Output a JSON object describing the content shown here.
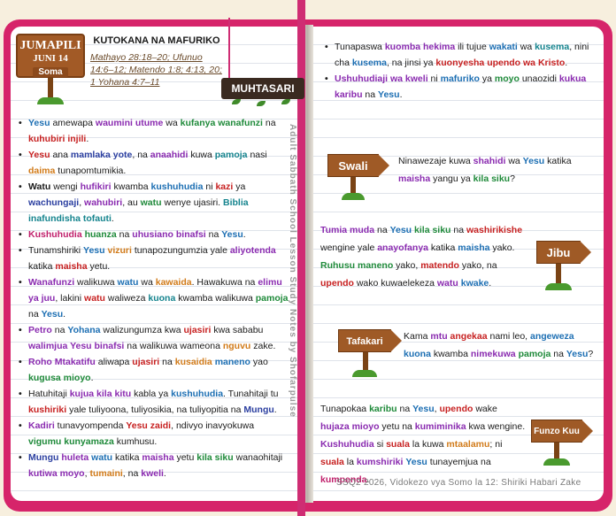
{
  "header": {
    "day": "JUMAPILI",
    "date": "JUNI 14",
    "read_label": "Soma",
    "topic": "KUTOKANA NA MAFURIKO",
    "refs": [
      "Mathayo 28:18–20; Ufunuo 14:6–12; Matendo 1:8; 4:13, 20; 1 Yohana 4:7–11"
    ],
    "summary_label": "MUHTASARI"
  },
  "left_list": [
    [
      [
        "Yesu",
        "blue"
      ],
      [
        " amewapa ",
        ""
      ],
      [
        "waumini utume",
        "purple"
      ],
      [
        " wa ",
        ""
      ],
      [
        "kufanya wanafunzi",
        "green"
      ],
      [
        " na ",
        ""
      ],
      [
        "kuhubiri injili",
        "red"
      ],
      [
        ".",
        ""
      ]
    ],
    [
      [
        "Yesu",
        "red"
      ],
      [
        " ana ",
        ""
      ],
      [
        "mamlaka yote",
        "navy"
      ],
      [
        ", na ",
        ""
      ],
      [
        "anaahidi",
        "purple"
      ],
      [
        " kuwa ",
        ""
      ],
      [
        "pamoja",
        "teal"
      ],
      [
        " nasi ",
        ""
      ],
      [
        "daima",
        "orange"
      ],
      [
        " tunapomtumikia.",
        ""
      ]
    ],
    [
      [
        "Watu",
        "b"
      ],
      [
        " wengi ",
        ""
      ],
      [
        "hufikiri",
        "purple"
      ],
      [
        " kwamba ",
        ""
      ],
      [
        "kushuhudia",
        "blue"
      ],
      [
        " ni ",
        ""
      ],
      [
        "kazi",
        "red"
      ],
      [
        " ya ",
        ""
      ],
      [
        "wachungaji",
        "navy"
      ],
      [
        ", ",
        ""
      ],
      [
        "wahubiri",
        "purple"
      ],
      [
        ", au ",
        ""
      ],
      [
        "watu",
        "green"
      ],
      [
        " wenye ujasiri. ",
        ""
      ],
      [
        "Biblia inafundisha tofauti",
        "teal"
      ],
      [
        ".",
        ""
      ]
    ],
    [
      [
        "Kushuhudia",
        "pink"
      ],
      [
        " ",
        ""
      ],
      [
        "huanza",
        "green"
      ],
      [
        " na ",
        ""
      ],
      [
        "uhusiano binafsi",
        "purple"
      ],
      [
        " na ",
        ""
      ],
      [
        "Yesu",
        "blue"
      ],
      [
        ".",
        ""
      ]
    ],
    [
      [
        "Tunamshiriki ",
        ""
      ],
      [
        "Yesu",
        "blue"
      ],
      [
        " ",
        ""
      ],
      [
        "vizuri",
        "orange"
      ],
      [
        " tunapozungumzia yale ",
        ""
      ],
      [
        "aliyotenda",
        "purple"
      ],
      [
        " katika ",
        ""
      ],
      [
        "maisha",
        "red"
      ],
      [
        " yetu.",
        ""
      ]
    ],
    [
      [
        "Wanafunzi",
        "purple"
      ],
      [
        " walikuwa ",
        ""
      ],
      [
        "watu",
        "blue"
      ],
      [
        " wa ",
        ""
      ],
      [
        "kawaida",
        "orange"
      ],
      [
        ". Hawakuwa na ",
        ""
      ],
      [
        "elimu ya juu",
        "purple"
      ],
      [
        ", lakini ",
        ""
      ],
      [
        "watu",
        "red"
      ],
      [
        " waliweza ",
        ""
      ],
      [
        "kuona",
        "teal"
      ],
      [
        " kwamba walikuwa ",
        ""
      ],
      [
        "pamoja",
        "green"
      ],
      [
        " na ",
        ""
      ],
      [
        "Yesu",
        "blue"
      ],
      [
        ".",
        ""
      ]
    ],
    [
      [
        "Petro",
        "purple"
      ],
      [
        " na ",
        ""
      ],
      [
        "Yohana",
        "blue"
      ],
      [
        " walizungumza kwa ",
        ""
      ],
      [
        "ujasiri",
        "red"
      ],
      [
        " kwa sababu ",
        ""
      ],
      [
        "walimjua Yesu binafsi",
        "purple"
      ],
      [
        " na walikuwa wameona ",
        ""
      ],
      [
        "nguvu",
        "orange"
      ],
      [
        " zake.",
        ""
      ]
    ],
    [
      [
        "Roho Mtakatifu",
        "purple"
      ],
      [
        " aliwapa ",
        ""
      ],
      [
        "ujasiri",
        "red"
      ],
      [
        " na ",
        ""
      ],
      [
        "kusaidia",
        "orange"
      ],
      [
        " ",
        ""
      ],
      [
        "maneno",
        "blue"
      ],
      [
        " yao ",
        ""
      ],
      [
        "kugusa mioyo",
        "green"
      ],
      [
        ".",
        ""
      ]
    ],
    [
      [
        "Hatuhitaji ",
        ""
      ],
      [
        "kujua kila kitu",
        "purple"
      ],
      [
        " kabla ya ",
        ""
      ],
      [
        "kushuhudia",
        "blue"
      ],
      [
        ". Tunahitaji tu ",
        ""
      ],
      [
        "kushiriki",
        "red"
      ],
      [
        " yale tuliyoona, tuliyosikia, na tuliyopitia na ",
        ""
      ],
      [
        "Mungu",
        "navy"
      ],
      [
        ".",
        ""
      ]
    ],
    [
      [
        "Kadiri",
        "purple"
      ],
      [
        " tunavyompenda ",
        ""
      ],
      [
        "Yesu zaidi",
        "red"
      ],
      [
        ", ndivyo inavyokuwa ",
        ""
      ],
      [
        "vigumu kunyamaza",
        "green"
      ],
      [
        " kumhusu.",
        ""
      ]
    ],
    [
      [
        "Mungu",
        "navy"
      ],
      [
        " ",
        ""
      ],
      [
        "huleta",
        "purple"
      ],
      [
        " ",
        ""
      ],
      [
        "watu",
        "blue"
      ],
      [
        " katika ",
        ""
      ],
      [
        "maisha",
        "purple"
      ],
      [
        " yetu ",
        ""
      ],
      [
        "kila siku",
        "green"
      ],
      [
        " wanaohitaji ",
        ""
      ],
      [
        "kutiwa moyo",
        "purple"
      ],
      [
        ", ",
        ""
      ],
      [
        "tumaini",
        "orange"
      ],
      [
        ", na ",
        ""
      ],
      [
        "kweli",
        "purple"
      ],
      [
        ".",
        ""
      ]
    ]
  ],
  "right_list": [
    [
      [
        "Tunapaswa ",
        ""
      ],
      [
        "kuomba hekima",
        "purple"
      ],
      [
        " ili tujue ",
        ""
      ],
      [
        "wakati",
        "blue"
      ],
      [
        " wa ",
        ""
      ],
      [
        "kusema",
        "teal"
      ],
      [
        ", nini cha ",
        ""
      ],
      [
        "kusema",
        "blue"
      ],
      [
        ", na jinsi ya ",
        ""
      ],
      [
        "kuonyesha upendo wa Kristo",
        "red"
      ],
      [
        ".",
        ""
      ]
    ],
    [
      [
        "Ushuhudiaji wa kweli",
        "purple"
      ],
      [
        " ni ",
        ""
      ],
      [
        "mafuriko",
        "blue"
      ],
      [
        " ya ",
        ""
      ],
      [
        "moyo",
        "green"
      ],
      [
        " unaozidi ",
        ""
      ],
      [
        "kukua karibu",
        "purple"
      ],
      [
        " na ",
        ""
      ],
      [
        "Yesu",
        "blue"
      ],
      [
        ".",
        ""
      ]
    ]
  ],
  "vertical_note": "Adult Sabbath School Lesson Study Notes by Shofarpulse",
  "swali": {
    "label": "Swali",
    "text": [
      [
        "Ninawezaje kuwa ",
        ""
      ],
      [
        "shahidi",
        "purple"
      ],
      [
        " wa ",
        ""
      ],
      [
        "Yesu",
        "blue"
      ],
      [
        " katika ",
        ""
      ],
      [
        "maisha",
        "purple"
      ],
      [
        " yangu ya ",
        ""
      ],
      [
        "kila siku",
        "green"
      ],
      [
        "?",
        ""
      ]
    ]
  },
  "jibu": {
    "label": "Jibu",
    "text": [
      [
        "Tumia muda",
        "purple"
      ],
      [
        " na ",
        ""
      ],
      [
        "Yesu",
        "blue"
      ],
      [
        " ",
        ""
      ],
      [
        "kila siku",
        "green"
      ],
      [
        " na ",
        ""
      ],
      [
        "washirikishe",
        "red"
      ],
      [
        " wengine yale ",
        ""
      ],
      [
        "anayofanya",
        "purple"
      ],
      [
        " katika ",
        ""
      ],
      [
        "maisha",
        "blue"
      ],
      [
        " yako. ",
        ""
      ],
      [
        "Ruhusu maneno",
        "green"
      ],
      [
        " yako, ",
        ""
      ],
      [
        "matendo",
        "red"
      ],
      [
        " yako, na ",
        ""
      ],
      [
        "upendo",
        "red"
      ],
      [
        " wako kuwaelekeza ",
        ""
      ],
      [
        "watu",
        "purple"
      ],
      [
        " ",
        ""
      ],
      [
        "kwake",
        "blue"
      ],
      [
        ".",
        ""
      ]
    ]
  },
  "tafakari": {
    "label": "Tafakari",
    "text": [
      [
        "Kama ",
        ""
      ],
      [
        "mtu",
        "purple"
      ],
      [
        " ",
        ""
      ],
      [
        "angekaa",
        "red"
      ],
      [
        " nami leo, ",
        ""
      ],
      [
        "angeweza kuona",
        "blue"
      ],
      [
        " kwamba ",
        ""
      ],
      [
        "nimekuwa",
        "purple"
      ],
      [
        " ",
        ""
      ],
      [
        "pamoja",
        "green"
      ],
      [
        " na ",
        ""
      ],
      [
        "Yesu",
        "blue"
      ],
      [
        "?",
        ""
      ]
    ]
  },
  "funzo_kuu": {
    "label": "Funzo Kuu",
    "text": [
      [
        "Tunapokaa ",
        ""
      ],
      [
        "karibu",
        "green"
      ],
      [
        " na ",
        ""
      ],
      [
        "Yesu",
        "blue"
      ],
      [
        ", ",
        ""
      ],
      [
        "upendo",
        "red"
      ],
      [
        " wake ",
        ""
      ],
      [
        "hujaza mioyo",
        "purple"
      ],
      [
        " yetu na ",
        ""
      ],
      [
        "kumiminika",
        "purple"
      ],
      [
        " kwa wengine. ",
        ""
      ],
      [
        "Kushuhudia",
        "purple"
      ],
      [
        " si ",
        ""
      ],
      [
        "suala",
        "red"
      ],
      [
        " la kuwa ",
        ""
      ],
      [
        "mtaalamu",
        "orange"
      ],
      [
        "; ni ",
        ""
      ],
      [
        "suala",
        "red"
      ],
      [
        " la ",
        ""
      ],
      [
        "kumshiriki",
        "purple"
      ],
      [
        " ",
        ""
      ],
      [
        "Yesu",
        "blue"
      ],
      [
        " tunayemjua na ",
        ""
      ],
      [
        "kumpenda",
        "pink"
      ],
      [
        ".",
        ""
      ]
    ]
  },
  "footer": "SSQ2 2026, Vidokezo vya Somo la 12: Shiriki Habari Zake",
  "colors": {
    "cover": "#d6246a",
    "wood": "#a25a26",
    "page": "#ffffff"
  }
}
